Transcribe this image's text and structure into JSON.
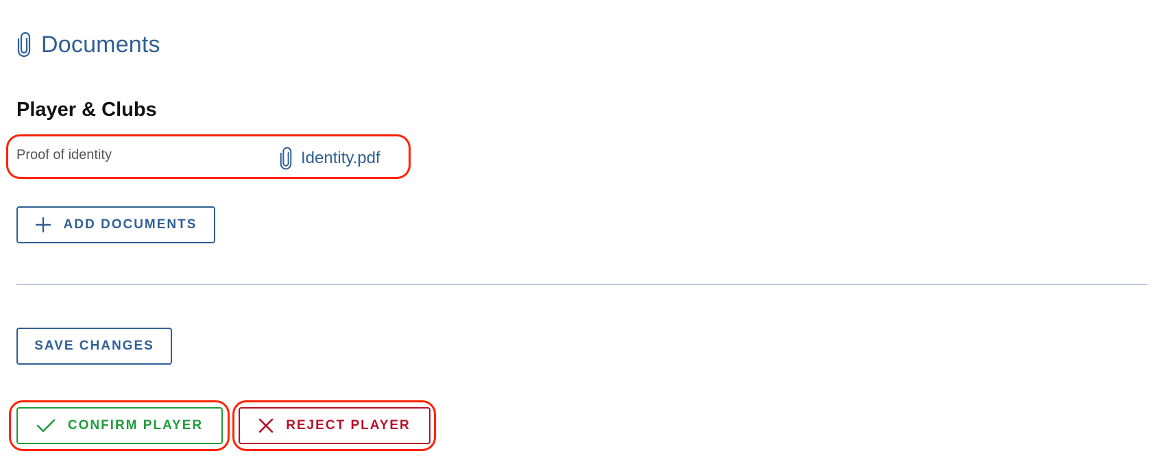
{
  "header": {
    "title": "Documents",
    "icon": "paperclip-icon"
  },
  "section": {
    "title": "Player & Clubs"
  },
  "documents": [
    {
      "label": "Proof of identity",
      "file_name": "Identity.pdf",
      "icon": "paperclip-icon"
    }
  ],
  "buttons": {
    "add_documents": "ADD DOCUMENTS",
    "save_changes": "SAVE CHANGES",
    "confirm_player": "CONFIRM PLAYER",
    "reject_player": "REJECT PLAYER"
  },
  "colors": {
    "primary": "#2f5f95",
    "confirm": "#1f9c3a",
    "reject": "#b5102a",
    "highlight": "#ff2200",
    "divider": "#b8c7dc"
  }
}
